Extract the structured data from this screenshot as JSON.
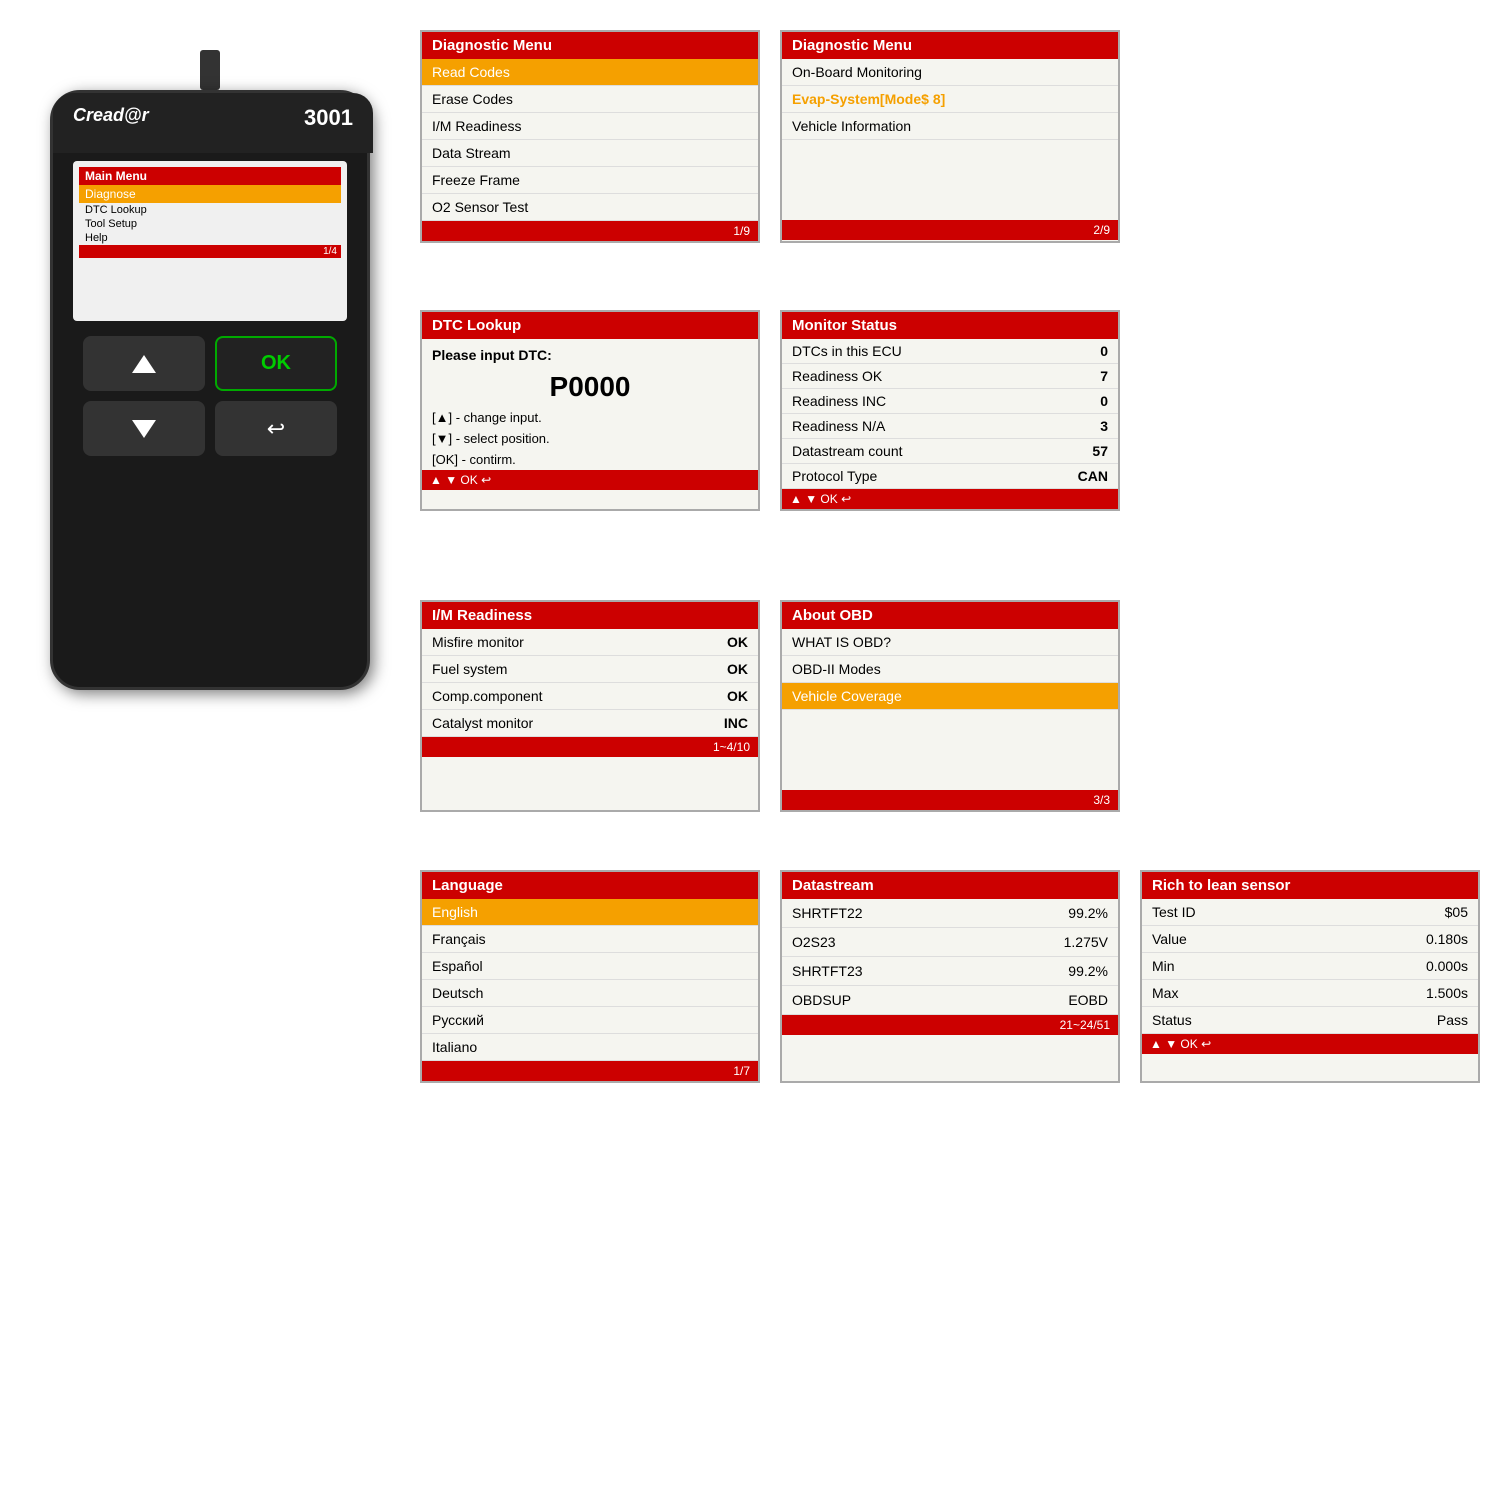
{
  "device": {
    "brand": "Cread@r",
    "model": "3001",
    "screen": {
      "header": "Main Menu",
      "items": [
        "Diagnose",
        "DTC Lookup",
        "Tool Setup",
        "Help"
      ],
      "selected": "Diagnose",
      "footer": "1/4"
    }
  },
  "panels": {
    "diagnostic_menu_1": {
      "title": "Diagnostic Menu",
      "selected": "Read Codes",
      "items": [
        "Erase Codes",
        "I/M Readiness",
        "Data Stream",
        "Freeze Frame",
        "O2 Sensor Test"
      ],
      "footer": "1/9"
    },
    "diagnostic_menu_2": {
      "title": "Diagnostic Menu",
      "items": [
        "On-Board Monitoring"
      ],
      "selected_orange": "Evap-System[Mode$ 8]",
      "items2": [
        "Vehicle Information"
      ],
      "footer": "2/9"
    },
    "dtc_lookup": {
      "title": "DTC Lookup",
      "input_label": "Please input DTC:",
      "code": "P0000",
      "instructions": [
        "[▲] - change input.",
        "[▼] - select position.",
        "[OK] - contirm."
      ],
      "nav": "▲ ▼ OK ↩"
    },
    "monitor_status": {
      "title": "Monitor Status",
      "rows": [
        {
          "label": "DTCs in this ECU",
          "value": "0"
        },
        {
          "label": "Readiness OK",
          "value": "7"
        },
        {
          "label": "Readiness INC",
          "value": "0"
        },
        {
          "label": "Readiness N/A",
          "value": "3"
        },
        {
          "label": "Datastream count",
          "value": "57"
        },
        {
          "label": "Protocol Type",
          "value": "CAN"
        }
      ],
      "nav": "▲ ▼ OK ↩"
    },
    "im_readiness": {
      "title": "I/M Readiness",
      "rows": [
        {
          "label": "Misfire monitor",
          "value": "OK"
        },
        {
          "label": "Fuel system",
          "value": "OK"
        },
        {
          "label": "Comp.component",
          "value": "OK"
        },
        {
          "label": "Catalyst monitor",
          "value": "INC"
        }
      ],
      "footer": "1~4/10"
    },
    "about_obd": {
      "title": "About OBD",
      "items": [
        "WHAT IS OBD?",
        "OBD-II Modes"
      ],
      "selected_orange": "Vehicle Coverage",
      "footer": "3/3"
    },
    "language": {
      "title": "Language",
      "selected": "English",
      "items": [
        "Français",
        "Español",
        "Deutsch",
        "Русский",
        "Italiano"
      ],
      "footer": "1/7"
    },
    "datastream": {
      "title": "Datastream",
      "rows": [
        {
          "label": "SHRTFT22",
          "value": "99.2%"
        },
        {
          "label": "O2S23",
          "value": "1.275V"
        },
        {
          "label": "SHRTFT23",
          "value": "99.2%"
        },
        {
          "label": "OBDSUP",
          "value": "EOBD"
        }
      ],
      "footer": "21~24/51"
    },
    "rich_lean_sensor": {
      "title": "Rich to lean sensor",
      "rows": [
        {
          "label": "Test ID",
          "value": "$05"
        },
        {
          "label": "Value",
          "value": "0.180s"
        },
        {
          "label": "Min",
          "value": "0.000s"
        },
        {
          "label": "Max",
          "value": "1.500s"
        },
        {
          "label": "Status",
          "value": "Pass"
        }
      ],
      "nav": "▲ ▼ OK ↩"
    }
  }
}
